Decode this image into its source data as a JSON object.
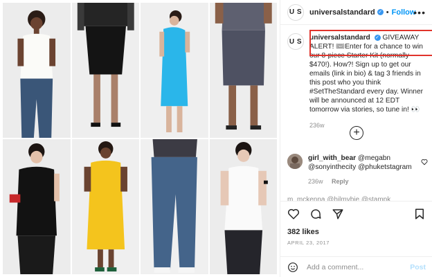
{
  "brand": {
    "initials": "U S",
    "username": "universalstandard",
    "verified_glyph": "✓",
    "separator": "•",
    "follow_label": "Follow",
    "more_label": "•••"
  },
  "caption": {
    "username": "universalstandard",
    "text": "GIVEAWAY ALERT! 🎟Enter for a chance to win our 8-piece Starter Kit (normally $470!). How?! Sign up to get our emails (link in bio) & tag 3 friends in this post who you think #SetTheStandard every day. Winner will be announced at 12 EDT tomorrow via stories, so tune in! 👀",
    "time_ago": "236w",
    "highlight_color": "#e0332b"
  },
  "load_more": {
    "icon": "plus-circle-icon",
    "glyph": "+"
  },
  "comments": [
    {
      "username": "girl_with_bear",
      "text": "@megabn @sonyinthecity @phuketstagram",
      "time_ago": "236w",
      "reply_label": "Reply"
    }
  ],
  "partial_comment": "m_mckenna @hilmybie @stampk",
  "actions": {
    "likes": "382 likes",
    "date": "APRIL 23, 2017",
    "icons": [
      "heart-icon",
      "comment-icon",
      "share-icon",
      "bookmark-icon"
    ]
  },
  "add_comment": {
    "placeholder": "Add a comment...",
    "post_label": "Post",
    "emoji_icon": "smile-icon"
  },
  "colors": {
    "accent": "#0095f6",
    "verified": "#3897f0",
    "muted": "#8e8e8e",
    "post_disabled": "#b2dffc"
  }
}
